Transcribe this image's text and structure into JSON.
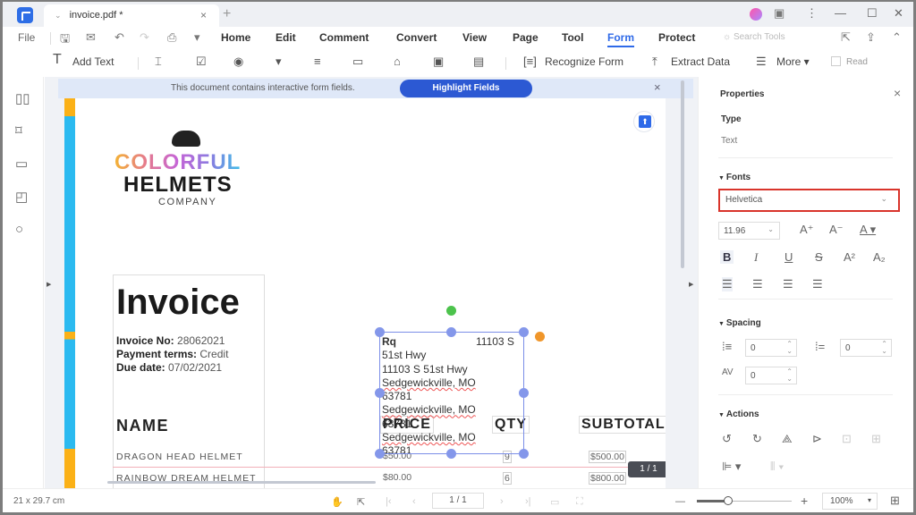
{
  "titlebar": {
    "tab_title": "invoice.pdf *",
    "tab_close": "×",
    "new_tab": "+",
    "window_controls": {
      "minimize": "—",
      "maximize": "☐",
      "close": "✕"
    },
    "icons": {
      "avatar": "●",
      "message": "▣",
      "more": "⋮"
    }
  },
  "menu": {
    "file": "File",
    "quick_actions": [
      "save-icon",
      "mail-icon",
      "undo-icon",
      "redo-icon",
      "print-icon",
      "dropdown-icon"
    ],
    "quick_glyphs": [
      "🖫",
      "✉",
      "↶",
      "↷",
      "⎙",
      "▾"
    ],
    "items": [
      "Home",
      "Edit",
      "Comment",
      "Convert",
      "View",
      "Page",
      "Tool",
      "Form",
      "Protect"
    ],
    "active": "Form",
    "search_placeholder": "Search Tools",
    "right_icons": [
      "⇱",
      "⇪",
      "⌃"
    ]
  },
  "toolbar": {
    "add_text": "Add Text",
    "form_tool_glyphs": [
      "⌶",
      "☑",
      "◉",
      "▾",
      "≡",
      "▭",
      "⌂",
      "▣",
      "▤"
    ],
    "recognize_form": "Recognize Form",
    "extract_data": "Extract Data",
    "more": "More",
    "read": "Read"
  },
  "leftbar": {
    "icons": [
      "▯▯",
      "⌑",
      "▭",
      "◰",
      "○"
    ]
  },
  "banner": {
    "text": "This document contains interactive form fields.",
    "button": "Highlight Fields",
    "close": "×"
  },
  "document": {
    "logo_line1": "COLORFUL",
    "logo_line2": "HELMETS",
    "logo_line3": "COMPANY",
    "invoice_title": "Invoice",
    "invoice_no_label": "Invoice No:",
    "invoice_no": "28062021",
    "payment_terms_label": "Payment terms:",
    "payment_terms": "Credit",
    "due_date_label": "Due date:",
    "due_date": "07/02/2021",
    "col_name": "NAME",
    "col_price": "PRICE",
    "col_qty": "QTY",
    "col_subtotal": "SUBTOTAL",
    "items": [
      {
        "name": "DRAGON HEAD HELMET",
        "price": "$50.00",
        "qty": "9",
        "subtotal": "$500.00"
      },
      {
        "name": "RAINBOW DREAM HELMET",
        "price": "$80.00",
        "qty": "6",
        "subtotal": "$800.00"
      }
    ],
    "address_field": {
      "line1": "Rq",
      "line1_right": "11103 S",
      "lines": [
        "51st Hwy",
        "11103 S 51st Hwy",
        "Sedgewickville, MO",
        "63781",
        "Sedgewickville, MO",
        "63781",
        "Sedgewickville, MO",
        "63781"
      ]
    },
    "page_indicator": "1 / 1"
  },
  "properties": {
    "title": "Properties",
    "close": "×",
    "type_label": "Type",
    "type_value": "Text",
    "fonts_label": "Fonts",
    "font_family": "Helvetica",
    "font_size": "11.96",
    "spacing_label": "Spacing",
    "line_spacing": "0",
    "paragraph_spacing": "0",
    "char_spacing": "0",
    "actions_label": "Actions"
  },
  "status": {
    "page_size": "21 x 29.7 cm",
    "page_input": "1 / 1",
    "zoom": "100%",
    "zoom_fraction": 0.33
  }
}
